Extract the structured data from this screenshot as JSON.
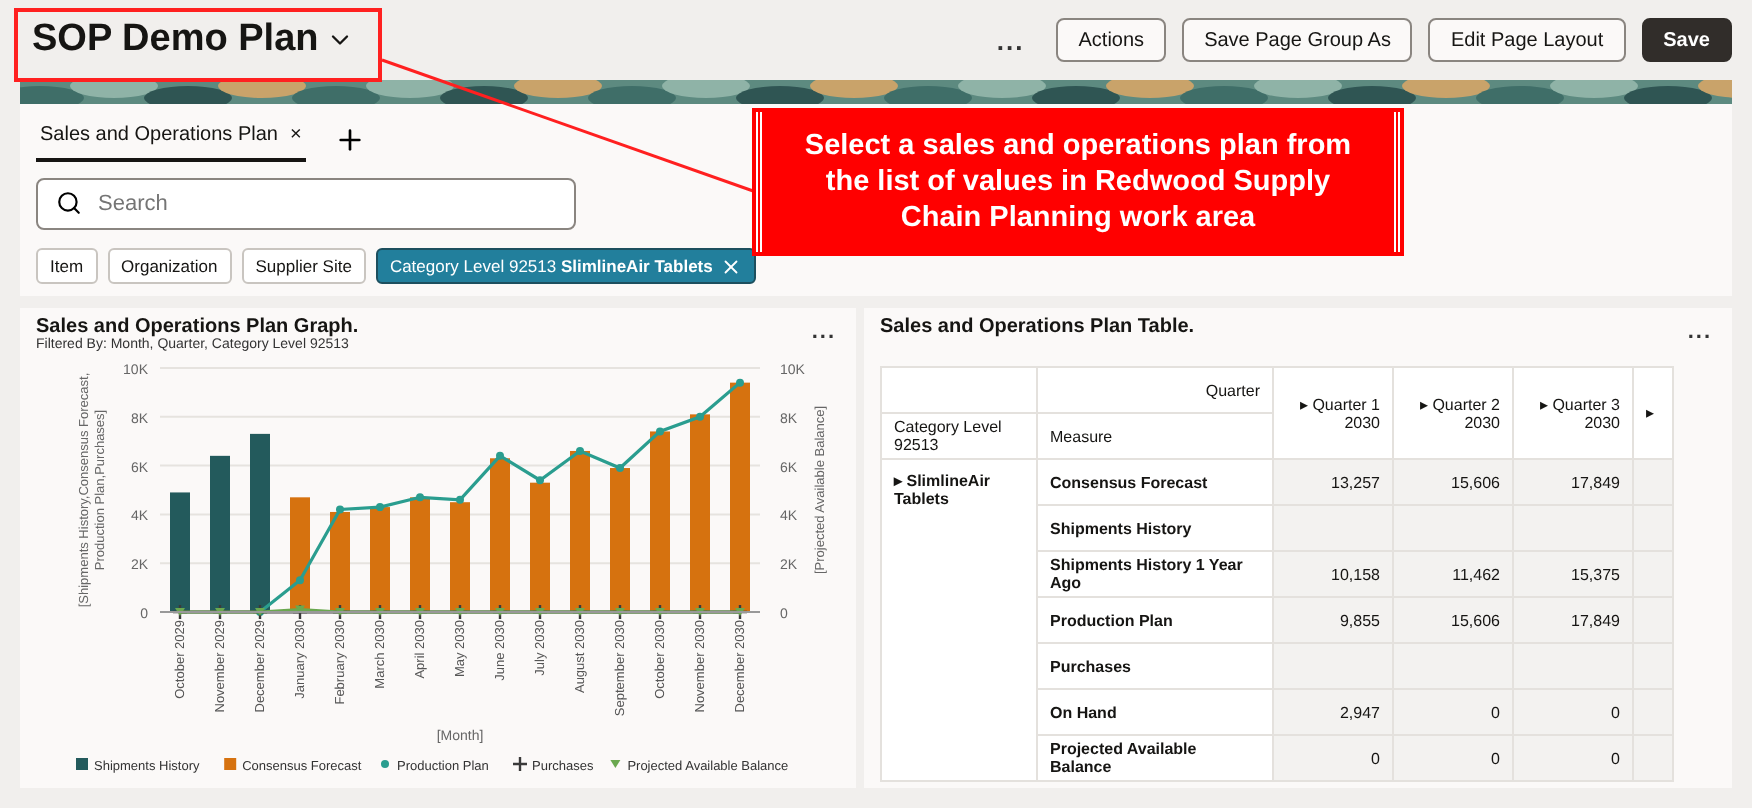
{
  "header": {
    "title": "SOP Demo Plan",
    "more": "...",
    "buttons": [
      {
        "label": "Actions",
        "kind": "secondary"
      },
      {
        "label": "Save Page Group As",
        "kind": "secondary"
      },
      {
        "label": "Edit Page Layout",
        "kind": "secondary"
      },
      {
        "label": "Save",
        "kind": "primary"
      }
    ]
  },
  "tabs": [
    {
      "label": "Sales and Operations Plan",
      "selected": true,
      "close": "×"
    }
  ],
  "search": {
    "placeholder": "Search"
  },
  "filters": [
    {
      "label": "Item",
      "selected": false
    },
    {
      "label": "Organization",
      "selected": false
    },
    {
      "label": "Supplier Site",
      "selected": false
    },
    {
      "label": "Category Level 92513 **SlimlineAir Tablets**",
      "selected": true
    }
  ],
  "callout": {
    "text": "Select a sales and operations plan from the list of values in Redwood Supply Chain Planning work area"
  },
  "graph": {
    "title": "Sales and Operations Plan Graph.",
    "subtitle": "Filtered By: Month, Quarter, Category Level 92513",
    "more": "...",
    "chart_data": {
      "type": "bar",
      "grid": true,
      "legend": "bottom",
      "xlabel": "[Month]",
      "ylabel": "[Shipments History,Consensus Forecast,Production Plan,Purchases]",
      "y2label": "[Projected Available Balance]",
      "ylim": [
        0,
        10000
      ],
      "yticks": [
        {
          "value": 0,
          "label": "0"
        },
        {
          "value": 2000,
          "label": "2K"
        },
        {
          "value": 4000,
          "label": "4K"
        },
        {
          "value": 6000,
          "label": "6K"
        },
        {
          "value": 8000,
          "label": "8K"
        },
        {
          "value": 10000,
          "label": "10K"
        }
      ],
      "categories": [
        "October 2029",
        "November 2029",
        "December 2029",
        "January 2030",
        "February 2030",
        "March 2030",
        "April 2030",
        "May 2030",
        "June 2030",
        "July 2030",
        "August 2030",
        "September 2030",
        "October 2030",
        "November 2030",
        "December 2030"
      ],
      "series": [
        {
          "name": "Shipments History",
          "type": "bar",
          "color": "#235a5c",
          "values": [
            4900,
            6400,
            7300,
            null,
            null,
            null,
            null,
            null,
            null,
            null,
            null,
            null,
            null,
            null,
            null
          ]
        },
        {
          "name": "Consensus Forecast",
          "type": "bar",
          "color": "#d6720f",
          "values": [
            null,
            null,
            null,
            4700,
            4100,
            4300,
            4700,
            4500,
            6300,
            5300,
            6600,
            5900,
            7400,
            8100,
            9400
          ]
        },
        {
          "name": "Production Plan",
          "type": "line",
          "marker": "circle",
          "color": "#2a9d8f",
          "values": [
            null,
            null,
            0,
            1300,
            4200,
            4300,
            4700,
            4600,
            6400,
            5400,
            6600,
            5900,
            7400,
            8000,
            9400
          ]
        },
        {
          "name": "Purchases",
          "type": "line",
          "marker": "plus",
          "color": "#3a3a3a",
          "values": [
            0,
            0,
            0,
            0,
            0,
            0,
            0,
            0,
            0,
            0,
            0,
            0,
            0,
            0,
            0
          ]
        },
        {
          "name": "Projected Available Balance",
          "type": "line",
          "marker": "triangle",
          "color": "#6aa84f",
          "values": [
            0,
            0,
            0,
            100,
            0,
            0,
            0,
            0,
            0,
            0,
            0,
            0,
            0,
            0,
            0
          ]
        }
      ]
    }
  },
  "table": {
    "title": "Sales and Operations Plan Table.",
    "more": "...",
    "expand_icon": "▸",
    "corner_label": "Quarter",
    "row_dimension": "Category Level 92513",
    "measure_label": "Measure",
    "item": "SlimlineAir Tablets",
    "columns": [
      "Quarter 1 2030",
      "Quarter 2 2030",
      "Quarter 3 2030"
    ],
    "rows": [
      {
        "measure": "Consensus Forecast",
        "values": [
          "13,257",
          "15,606",
          "17,849"
        ]
      },
      {
        "measure": "Shipments History",
        "values": []
      },
      {
        "measure": "Shipments History 1 Year Ago",
        "values": [
          "10,158",
          "11,462",
          "15,375"
        ]
      },
      {
        "measure": "Production Plan",
        "values": [
          "9,855",
          "15,606",
          "17,849"
        ]
      },
      {
        "measure": "Purchases",
        "values": []
      },
      {
        "measure": "On Hand",
        "values": [
          "2,947",
          "0",
          "0"
        ]
      },
      {
        "measure": "Projected Available Balance",
        "values": [
          "0",
          "0",
          "0"
        ]
      }
    ]
  }
}
